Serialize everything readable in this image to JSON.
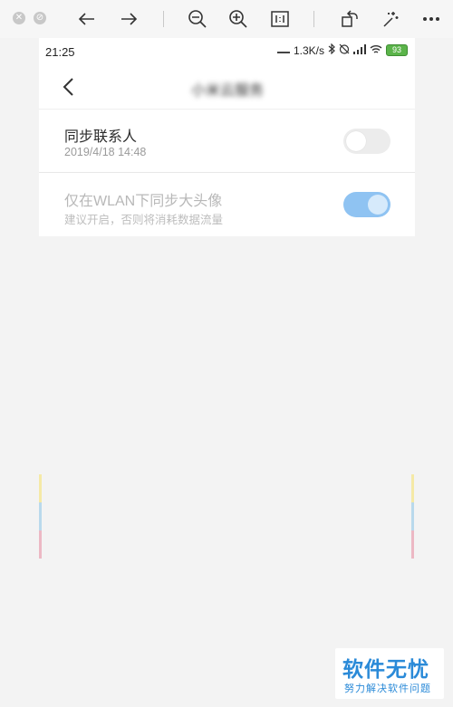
{
  "viewer": {
    "toolbar": {
      "close_icon": "close-icon",
      "minimize_icon": "minimize-icon",
      "icons": [
        "back-arrow-icon",
        "forward-arrow-icon",
        "zoom-out-icon",
        "zoom-in-icon",
        "actual-size-icon",
        "rotate-icon",
        "magic-wand-icon",
        "more-icon"
      ]
    }
  },
  "phone": {
    "status": {
      "time": "21:25",
      "net_speed": "1.3K/s",
      "battery": "93",
      "icons": [
        "signal-dots-icon",
        "bluetooth-icon",
        "alarm-off-icon",
        "signal-bars-icon",
        "wifi-icon",
        "battery-icon"
      ]
    },
    "nav": {
      "back_icon": "chevron-left-icon",
      "title": "小米云服务"
    },
    "settings": [
      {
        "title": "同步联系人",
        "subtitle": "2019/4/18 14:48",
        "toggle_on": false
      },
      {
        "title": "仅在WLAN下同步大头像",
        "subtitle": "建议开启，否则将消耗数据流量",
        "toggle_on": true
      }
    ]
  },
  "deco_colors": [
    "#f5e9a6",
    "#b9d9ec",
    "#ecb8c4"
  ],
  "watermark": {
    "main": "软件无忧",
    "sub": "努力解决软件问题"
  },
  "colors": {
    "accent": "#2a8ad8",
    "toggle_on": "#8fc3f2",
    "toggle_off": "#ececec"
  }
}
